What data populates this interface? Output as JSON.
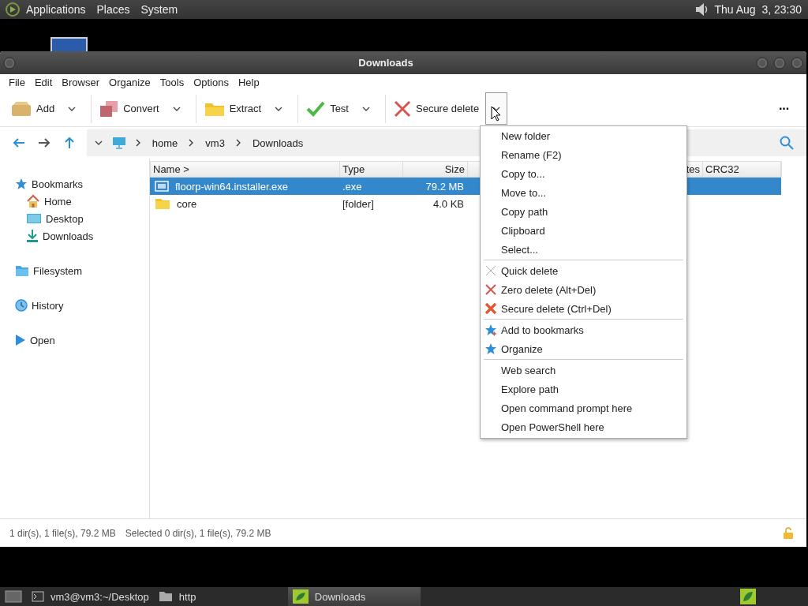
{
  "top_panel": {
    "menus": [
      "Applications",
      "Places",
      "System"
    ],
    "clock": "Thu Aug  3, 23:30"
  },
  "window": {
    "title": "Downloads",
    "menu_bar": [
      "File",
      "Edit",
      "Browser",
      "Organize",
      "Tools",
      "Options",
      "Help"
    ],
    "toolbar": {
      "buttons": [
        {
          "kind": "add",
          "label": "Add",
          "caret_pressed": false
        },
        {
          "kind": "convert",
          "label": "Convert",
          "caret_pressed": false
        },
        {
          "kind": "extract",
          "label": "Extract",
          "caret_pressed": false
        },
        {
          "kind": "test",
          "label": "Test",
          "caret_pressed": false
        },
        {
          "kind": "delete",
          "label": "Secure delete",
          "caret_pressed": true
        }
      ],
      "more": "···"
    },
    "address": {
      "crumbs": [
        "home",
        "vm3",
        "Downloads"
      ]
    },
    "sidebar": {
      "sections": [
        {
          "kind": "bookmarks",
          "label": "Bookmarks",
          "children": [
            {
              "kind": "home",
              "label": "Home"
            },
            {
              "kind": "desktop",
              "label": "Desktop"
            },
            {
              "kind": "downloads",
              "label": "Downloads"
            }
          ]
        },
        {
          "kind": "filesystem",
          "label": "Filesystem"
        },
        {
          "kind": "history",
          "label": "History"
        },
        {
          "kind": "open",
          "label": "Open"
        }
      ]
    },
    "table": {
      "columns": [
        "Name >",
        "Type",
        "Size",
        "tes",
        "CRC32"
      ],
      "rows": [
        {
          "kind": "file",
          "name": "floorp-win64.installer.exe",
          "type": ".exe",
          "size": "79.2 MB",
          "selected": true
        },
        {
          "kind": "folder",
          "name": "core",
          "type": "[folder]",
          "size": "4.0 KB",
          "selected": false
        }
      ]
    },
    "status_bar": {
      "texts": [
        "1 dir(s), 1 file(s), 79.2 MB",
        "Selected 0 dir(s), 1 file(s), 79.2 MB"
      ]
    }
  },
  "context_menu": {
    "groups": [
      [
        {
          "kind": "plain",
          "label": "New folder"
        },
        {
          "kind": "plain",
          "label": "Rename (F2)"
        },
        {
          "kind": "plain",
          "label": "Copy to..."
        },
        {
          "kind": "plain",
          "label": "Move to..."
        },
        {
          "kind": "plain",
          "label": "Copy path"
        },
        {
          "kind": "plain",
          "label": "Clipboard"
        },
        {
          "kind": "plain",
          "label": "Select..."
        }
      ],
      [
        {
          "kind": "quick-delete",
          "label": "Quick delete"
        },
        {
          "kind": "zero-delete",
          "label": "Zero delete (Alt+Del)"
        },
        {
          "kind": "secure-delete",
          "label": "Secure delete (Ctrl+Del)"
        }
      ],
      [
        {
          "kind": "bookmark-add",
          "label": "Add to bookmarks"
        },
        {
          "kind": "organize",
          "label": "Organize"
        }
      ],
      [
        {
          "kind": "plain",
          "label": "Web search"
        },
        {
          "kind": "plain",
          "label": "Explore path"
        },
        {
          "kind": "plain",
          "label": "Open command prompt here"
        },
        {
          "kind": "plain",
          "label": "Open PowerShell here"
        }
      ]
    ]
  },
  "taskbar": {
    "items": [
      {
        "kind": "terminal",
        "label": "vm3@vm3:~/Desktop",
        "selected": false
      },
      {
        "kind": "folder",
        "label": "http",
        "selected": false
      },
      {
        "kind": "app",
        "label": "Downloads",
        "selected": true
      }
    ]
  }
}
